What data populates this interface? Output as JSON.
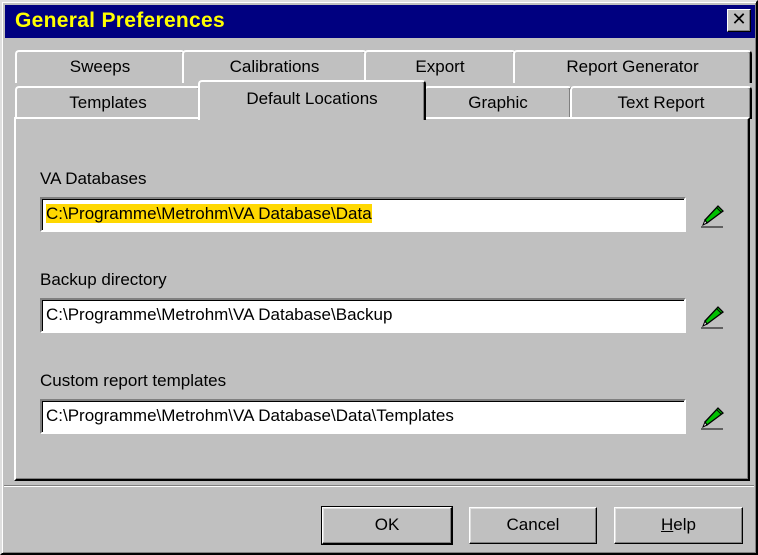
{
  "window": {
    "title": "General Preferences",
    "close_glyph": "✕"
  },
  "tabs": {
    "row1": [
      {
        "label": "Sweeps"
      },
      {
        "label": "Calibrations"
      },
      {
        "label": "Export"
      },
      {
        "label": "Report Generator"
      }
    ],
    "row2": [
      {
        "label": "Templates"
      },
      {
        "label": "Default Locations",
        "active": true
      },
      {
        "label": "Graphic"
      },
      {
        "label": "Text Report"
      }
    ]
  },
  "fields": [
    {
      "label": "VA Databases",
      "value": "C:\\Programme\\Metrohm\\VA Database\\Data",
      "selected": true,
      "browse_icon": "pencil-icon"
    },
    {
      "label": "Backup directory",
      "value": "C:\\Programme\\Metrohm\\VA Database\\Backup",
      "selected": false,
      "browse_icon": "pencil-icon"
    },
    {
      "label": "Custom report templates",
      "value": "C:\\Programme\\Metrohm\\VA Database\\Data\\Templates",
      "selected": false,
      "browse_icon": "pencil-icon"
    }
  ],
  "buttons": {
    "ok": "OK",
    "cancel": "Cancel",
    "help_mnemonic": "H",
    "help_rest": "elp"
  },
  "colors": {
    "title_bg": "#000080",
    "title_text": "#ffff00",
    "selection_highlight": "#ffd800",
    "pencil_green": "#00c000"
  }
}
